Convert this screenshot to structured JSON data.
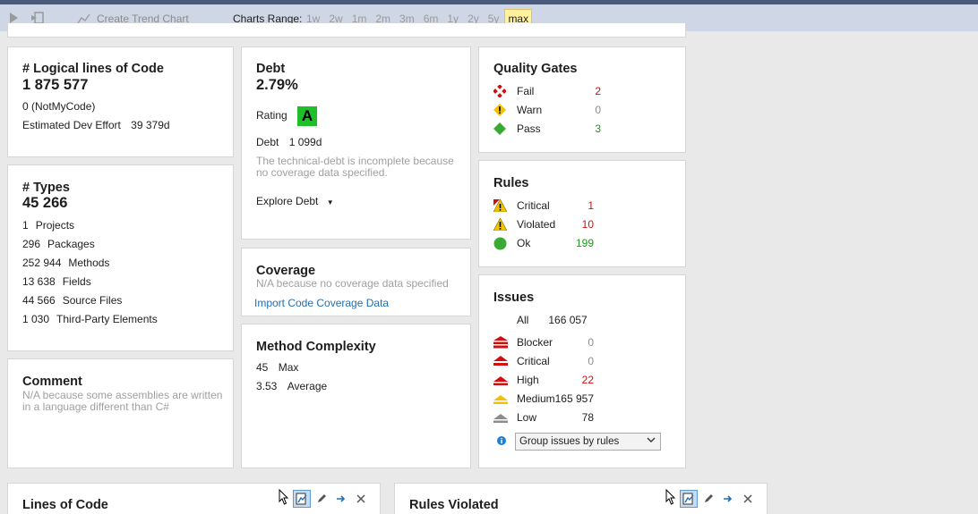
{
  "toolbar": {
    "create_trend": "Create Trend Chart",
    "charts_range_label": "Charts Range:",
    "ranges": [
      "1w",
      "2w",
      "1m",
      "2m",
      "3m",
      "6m",
      "1y",
      "2y",
      "5y",
      "max"
    ],
    "selected_range": "max"
  },
  "loc": {
    "title": "# Logical lines of Code",
    "value": "1 875 577",
    "not_my_code": "0   (NotMyCode)",
    "effort_label": "Estimated Dev Effort",
    "effort_value": "39 379d"
  },
  "types": {
    "title": "# Types",
    "value": "45 266",
    "items": [
      {
        "n": "1",
        "label": "Projects"
      },
      {
        "n": "296",
        "label": "Packages"
      },
      {
        "n": "252 944",
        "label": "Methods"
      },
      {
        "n": "13 638",
        "label": "Fields"
      },
      {
        "n": "44 566",
        "label": "Source Files"
      },
      {
        "n": "1 030",
        "label": "Third-Party Elements"
      }
    ]
  },
  "comment": {
    "title": "Comment",
    "note": "N/A because some assemblies are written in a language different than C#"
  },
  "debt": {
    "title": "Debt",
    "value": "2.79%",
    "rating_label": "Rating",
    "rating": "A",
    "debt_label": "Debt",
    "debt_value": "1 099d",
    "note": "The technical-debt is incomplete because no coverage data specified.",
    "explore": "Explore Debt"
  },
  "coverage": {
    "title": "Coverage",
    "note": "N/A because no coverage data specified",
    "import": "Import Code Coverage Data"
  },
  "complexity": {
    "title": "Method Complexity",
    "max_value": "45",
    "max_label": "Max",
    "avg_value": "3.53",
    "avg_label": "Average"
  },
  "quality": {
    "title": "Quality Gates",
    "rows": [
      {
        "label": "Fail",
        "value": "2"
      },
      {
        "label": "Warn",
        "value": "0"
      },
      {
        "label": "Pass",
        "value": "3"
      }
    ]
  },
  "rules": {
    "title": "Rules",
    "rows": [
      {
        "label": "Critical",
        "value": "1"
      },
      {
        "label": "Violated",
        "value": "10"
      },
      {
        "label": "Ok",
        "value": "199"
      }
    ]
  },
  "issues": {
    "title": "Issues",
    "all_label": "All",
    "all_value": "166 057",
    "rows": [
      {
        "label": "Blocker",
        "value": "0"
      },
      {
        "label": "Critical",
        "value": "0"
      },
      {
        "label": "High",
        "value": "22"
      },
      {
        "label": "Medium",
        "value": "165 957"
      },
      {
        "label": "Low",
        "value": "78"
      }
    ],
    "group_select": "Group issues by rules"
  },
  "panels": {
    "lines_of_code": "Lines of Code",
    "rules_violated": "Rules Violated"
  },
  "colors": {
    "fail": "#d01010",
    "pass": "#3aaa35",
    "warn": "#f2c200",
    "rating": "#1fbf2a",
    "link": "#1f6fb5"
  }
}
